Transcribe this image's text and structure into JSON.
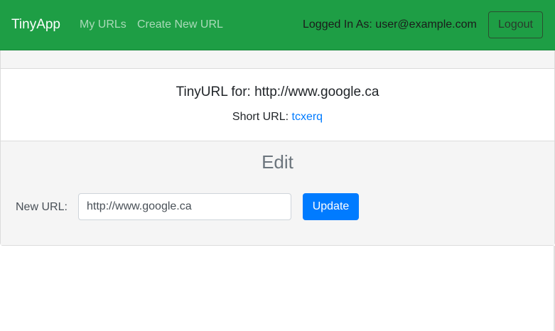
{
  "navbar": {
    "brand": "TinyApp",
    "links": [
      "My URLs",
      "Create New URL"
    ],
    "logged_in_text": "Logged In As: user@example.com",
    "logout_label": "Logout",
    "background_color": "#1e9e45"
  },
  "card": {
    "title": "TinyURL for: http://www.google.ca",
    "short_url_label": "Short URL: ",
    "short_url_value": "tcxerq",
    "edit": {
      "heading": "Edit",
      "new_url_label": "New URL:",
      "new_url_value": "http://www.google.ca",
      "update_label": "Update",
      "button_color": "#007bff"
    }
  }
}
